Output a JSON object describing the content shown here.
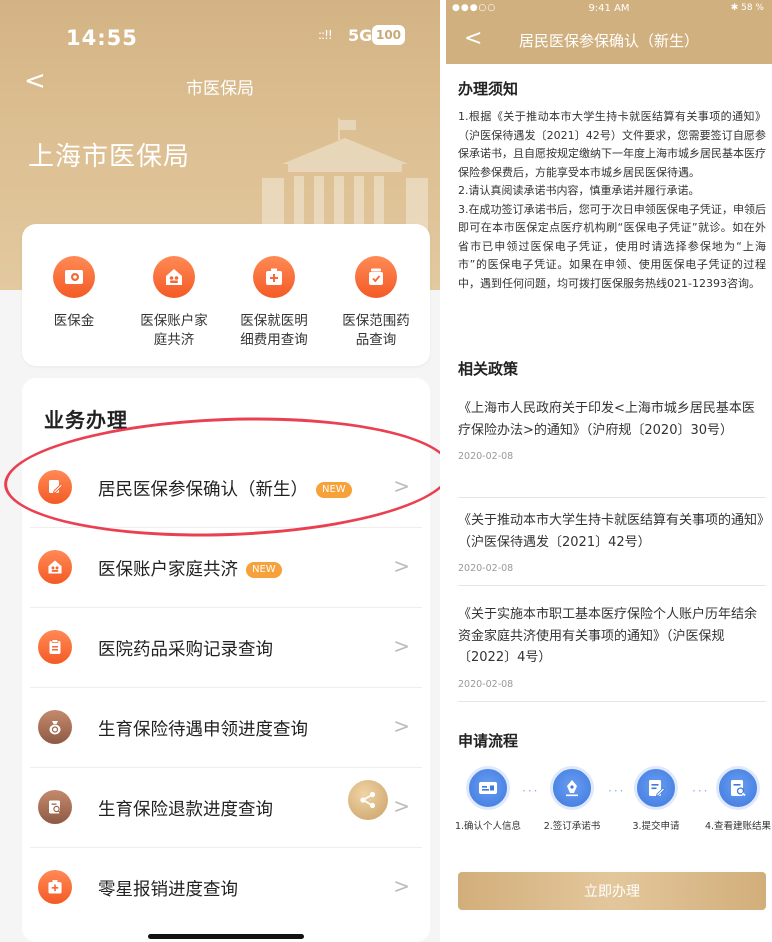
{
  "left": {
    "status": {
      "time": "14:55",
      "signal": "::!!",
      "network": "5G",
      "battery": "100"
    },
    "nav": {
      "back": "<",
      "title": "市医保局"
    },
    "hero": {
      "title": "上海市医保局"
    },
    "quick": [
      {
        "label": "医保金",
        "icon": "insurance-card-icon"
      },
      {
        "label": "医保账户家庭共济",
        "icon": "family-icon"
      },
      {
        "label": "医保就医明细费用查询",
        "icon": "medical-kit-icon"
      },
      {
        "label": "医保范围药品查询",
        "icon": "medicine-icon"
      }
    ],
    "biz": {
      "title": "业务办理",
      "badge": "NEW",
      "chevron": ">",
      "items": [
        {
          "label": "居民医保参保确认（新生）",
          "badge": true,
          "icon": "edit-document-icon",
          "tone": "orange"
        },
        {
          "label": "医保账户家庭共济",
          "badge": true,
          "icon": "family-icon",
          "tone": "orange"
        },
        {
          "label": "医院药品采购记录查询",
          "badge": false,
          "icon": "clipboard-icon",
          "tone": "orange"
        },
        {
          "label": "生育保险待遇申领进度查询",
          "badge": false,
          "icon": "money-bag-icon",
          "tone": "brown"
        },
        {
          "label": "生育保险退款进度查询",
          "badge": false,
          "icon": "search-document-icon",
          "tone": "brown"
        },
        {
          "label": "零星报销进度查询",
          "badge": false,
          "icon": "medical-kit-icon",
          "tone": "orange"
        }
      ]
    }
  },
  "right": {
    "status": {
      "carrier": "●●●○○ ",
      "time": "9:41 AM",
      "battery": "✱ 58 %"
    },
    "nav": {
      "back": "<",
      "title": "居民医保参保确认（新生）"
    },
    "notice": {
      "heading": "办理须知",
      "paragraphs": [
        "1.根据《关于推动本市大学生持卡就医结算有关事项的通知》（沪医保待遇发〔2021〕42号）文件要求，您需要签订自愿参保承诺书，且自愿按规定缴纳下一年度上海市城乡居民基本医疗保险参保费后，方能享受本市城乡居民医保待遇。",
        "2.请认真阅读承诺书内容，慎重承诺并履行承诺。",
        "3.在成功签订承诺书后，您可于次日申领医保电子凭证，申领后即可在本市医保定点医疗机构刷“医保电子凭证”就诊。如在外省市已申领过医保电子凭证，使用时请选择参保地为“上海市”的医保电子凭证。如果在申领、使用医保电子凭证的过程中，遇到任何问题，均可拨打医保服务热线021-12393咨询。"
      ]
    },
    "policies": {
      "heading": "相关政策",
      "items": [
        {
          "title": "《上海市人民政府关于印发<上海市城乡居民基本医疗保险办法>的通知》（沪府规〔2020〕30号）",
          "date": "2020-02-08"
        },
        {
          "title": "《关于推动本市大学生持卡就医结算有关事项的通知》（沪医保待遇发〔2021〕42号）",
          "date": "2020-02-08"
        },
        {
          "title": "《关于实施本市职工基本医疗保险个人账户历年结余资金家庭共济使用有关事项的通知》（沪医保规〔2022〕4号）",
          "date": "2020-02-08"
        }
      ]
    },
    "flow": {
      "heading": "申请流程",
      "dots": "···",
      "steps": [
        {
          "label": "1.确认个人信息",
          "icon": "id-card-icon"
        },
        {
          "label": "2.签订承诺书",
          "icon": "sign-pen-icon"
        },
        {
          "label": "3.提交申请",
          "icon": "submit-document-icon"
        },
        {
          "label": "4.查看建账结果",
          "icon": "search-document-icon"
        }
      ]
    },
    "button": "立即办理"
  }
}
